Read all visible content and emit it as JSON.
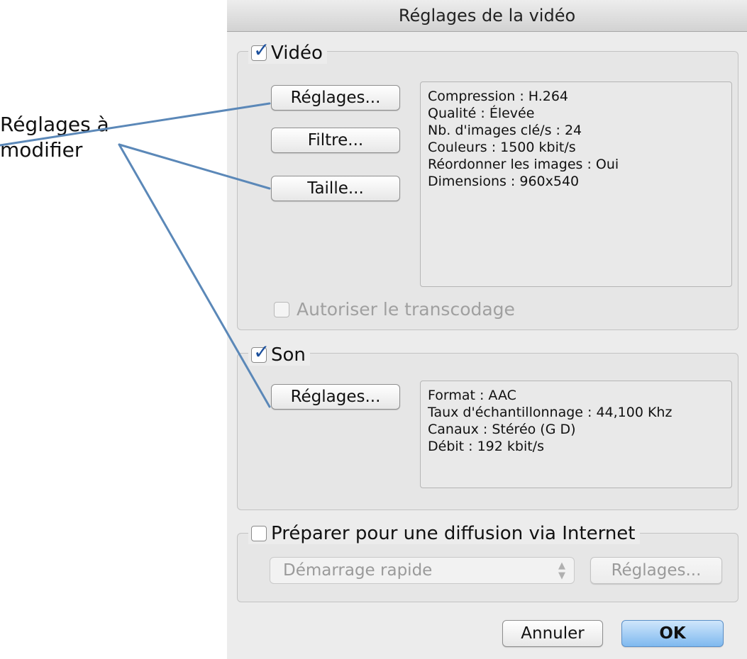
{
  "annotation": {
    "label_line1": "Réglages à",
    "label_line2": "modifier"
  },
  "dialog": {
    "title": "Réglages de la vidéo",
    "video": {
      "label": "Vidéo",
      "checked": true,
      "buttons": {
        "settings": "Réglages...",
        "filter": "Filtre...",
        "size": "Taille..."
      },
      "info": [
        "Compression : H.264",
        "Qualité : Élevée",
        "Nb. d'images clé/s : 24",
        "Couleurs : 1500 kbit/s",
        "Réordonner les images : Oui",
        "Dimensions : 960x540"
      ],
      "transcode_label": "Autoriser le transcodage"
    },
    "sound": {
      "label": "Son",
      "checked": true,
      "buttons": {
        "settings": "Réglages..."
      },
      "info": [
        "Format : AAC",
        "Taux d'échantillonnage : 44,100 Khz",
        "Canaux : Stéréo (G D)",
        "Débit : 192 kbit/s"
      ]
    },
    "internet": {
      "label": "Préparer pour une diffusion via Internet",
      "checked": false,
      "select_value": "Démarrage rapide",
      "settings_label": "Réglages..."
    },
    "footer": {
      "cancel": "Annuler",
      "ok": "OK"
    }
  }
}
